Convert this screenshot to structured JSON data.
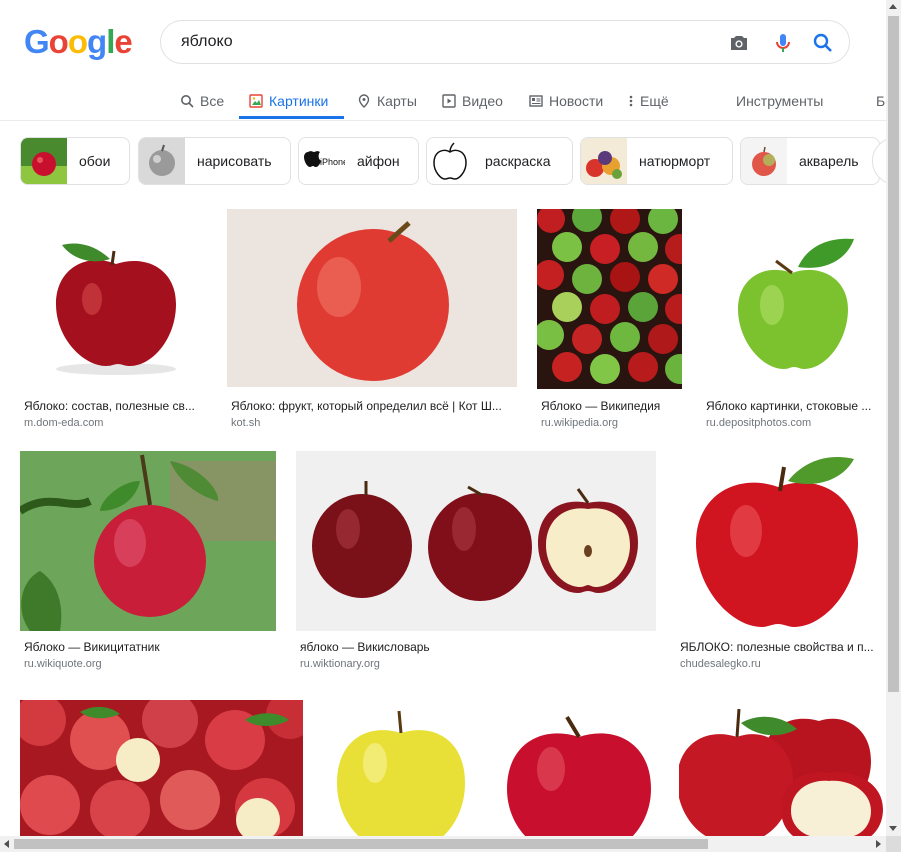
{
  "logo": {
    "letters": [
      "G",
      "o",
      "o",
      "g",
      "l",
      "e"
    ],
    "colors": [
      "#4285F4",
      "#EA4335",
      "#FBBC05",
      "#4285F4",
      "#34A853",
      "#EA4335"
    ]
  },
  "search": {
    "query": "яблоко",
    "icons": [
      "camera-icon",
      "mic-icon",
      "search-icon"
    ]
  },
  "tabs": [
    {
      "label": "Все",
      "icon": "search-icon",
      "active": false
    },
    {
      "label": "Картинки",
      "icon": "image-icon",
      "active": true
    },
    {
      "label": "Карты",
      "icon": "map-pin-icon",
      "active": false
    },
    {
      "label": "Видео",
      "icon": "video-icon",
      "active": false
    },
    {
      "label": "Новости",
      "icon": "news-icon",
      "active": false
    },
    {
      "label": "Ещё",
      "icon": "more-icon",
      "active": false
    }
  ],
  "tools": {
    "label": "Инструменты",
    "extra": "Бе"
  },
  "chips": [
    {
      "label": "обои"
    },
    {
      "label": "нарисовать"
    },
    {
      "label": "айфон",
      "thumb_text": "iPhone"
    },
    {
      "label": "раскраска"
    },
    {
      "label": "натюрморт"
    },
    {
      "label": "акварель"
    }
  ],
  "results": [
    {
      "title": "Яблоко: состав, полезные св...",
      "source": "m.dom-eda.com"
    },
    {
      "title": "Яблоко: фрукт, который определил всё | Кот Ш...",
      "source": "kot.sh"
    },
    {
      "title": "Яблоко — Википедия",
      "source": "ru.wikipedia.org"
    },
    {
      "title": "Яблоко картинки, стоковые ...",
      "source": "ru.depositphotos.com"
    },
    {
      "title": "Яблоко — Викицитатник",
      "source": "ru.wikiquote.org"
    },
    {
      "title": "яблоко — Викисловарь",
      "source": "ru.wiktionary.org"
    },
    {
      "title": "ЯБЛОКО: полезные свойства и п...",
      "source": "chudesalegko.ru"
    },
    {
      "title": "",
      "source": ""
    },
    {
      "title": "",
      "source": ""
    },
    {
      "title": "",
      "source": ""
    },
    {
      "title": "",
      "source": ""
    }
  ],
  "colors": {
    "accent": "#1a73e8",
    "apple_red": "#c8102e",
    "apple_green": "#7cc22e",
    "leaf": "#3f9a2a"
  }
}
